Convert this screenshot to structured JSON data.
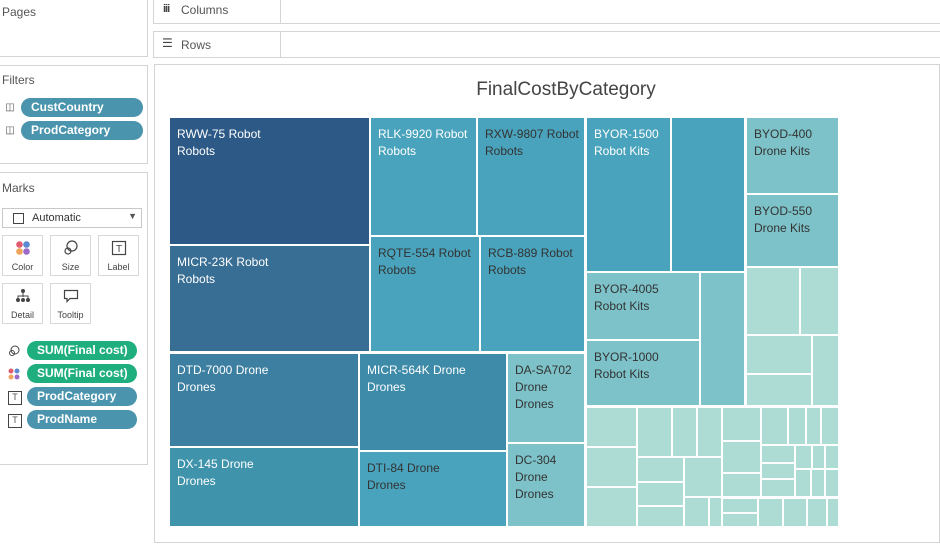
{
  "shelves": {
    "pages_label": "Pages",
    "columns_label": "Columns",
    "rows_label": "Rows",
    "filters_label": "Filters",
    "filters": [
      "CustCountry",
      "ProdCategory"
    ],
    "marks_label": "Marks",
    "mark_type": "Automatic",
    "mark_buttons": [
      "Color",
      "Size",
      "Label",
      "Detail",
      "Tooltip"
    ],
    "mark_pills": [
      "SUM(Final cost)",
      "SUM(Final cost)",
      "ProdCategory",
      "ProdName"
    ]
  },
  "chart": {
    "title": "FinalCostByCategory",
    "type": "treemap",
    "colors": {
      "dark": "#2c5985",
      "mid": "#3d7fa1",
      "teal": "#4aa3bc",
      "light": "#7cc2c8",
      "pale": "#acdcd4"
    }
  },
  "chart_data": {
    "type": "treemap",
    "groups": [
      {
        "category": "Robots",
        "products": [
          {
            "label": "RWW-75 Robot",
            "category": "Robots"
          },
          {
            "label": "MICR-23K Robot",
            "category": "Robots"
          },
          {
            "label": "RLK-9920 Robot",
            "category": "Robots"
          },
          {
            "label": "RXW-9807 Robot",
            "category": "Robots"
          },
          {
            "label": "RQTE-554 Robot",
            "category": "Robots"
          },
          {
            "label": "RCB-889 Robot",
            "category": "Robots"
          }
        ]
      },
      {
        "category": "Drones",
        "products": [
          {
            "label": "DTD-7000 Drone",
            "category": "Drones"
          },
          {
            "label": "DX-145 Drone",
            "category": "Drones"
          },
          {
            "label": "MICR-564K Drone",
            "category": "Drones"
          },
          {
            "label": "DTI-84 Drone",
            "category": "Drones"
          },
          {
            "label": "DA-SA702 Drone",
            "category": "Drones"
          },
          {
            "label": "DC-304 Drone",
            "category": "Drones"
          }
        ]
      },
      {
        "category": "Robot Kits",
        "products": [
          {
            "label": "BYOR-1500",
            "category": "Robot Kits"
          },
          {
            "label": "BYOR-4005",
            "category": "Robot Kits"
          },
          {
            "label": "BYOR-1000",
            "category": "Robot Kits"
          }
        ]
      },
      {
        "category": "Drone Kits",
        "products": [
          {
            "label": "BYOD-400",
            "category": "Drone Kits"
          },
          {
            "label": "BYOD-550",
            "category": "Drone Kits"
          }
        ]
      }
    ]
  }
}
